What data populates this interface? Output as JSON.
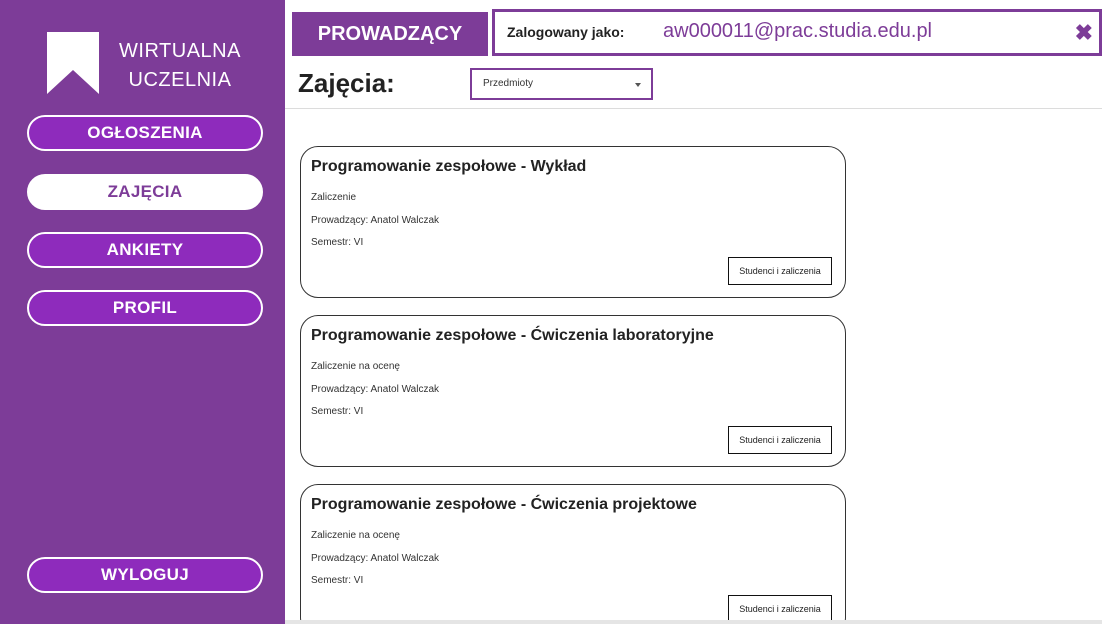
{
  "colors": {
    "brand": "#7d3c98",
    "nav_button": "#8e2bbc",
    "active_button": "#ffffff"
  },
  "logo": {
    "line1": "WIRTUALNA",
    "line2": "UCZELNIA",
    "icon": "bookmark-icon"
  },
  "nav": {
    "items": [
      {
        "label": "OGŁOSZENIA",
        "active": false
      },
      {
        "label": "ZAJĘCIA",
        "active": true
      },
      {
        "label": "ANKIETY",
        "active": false
      },
      {
        "label": "PROFIL",
        "active": false
      }
    ],
    "logout": "WYLOGUJ"
  },
  "header": {
    "role": "PROWADZĄCY",
    "logged_label": "Zalogowany jako:",
    "email": "aw000011@prac.studia.edu.pl",
    "close_icon": "close-icon"
  },
  "page": {
    "title": "Zajęcia:",
    "filter": {
      "selected": "Przedmioty"
    }
  },
  "courses": [
    {
      "title": "Programowanie zespołowe - Wykład",
      "assessment": "Zaliczenie",
      "teacher": "Prowadzący: Anatol Walczak",
      "semester": "Semestr: VI",
      "button": "Studenci i zaliczenia"
    },
    {
      "title": "Programowanie zespołowe - Ćwiczenia laboratoryjne",
      "assessment": "Zaliczenie na ocenę",
      "teacher": "Prowadzący: Anatol Walczak",
      "semester": "Semestr: VI",
      "button": "Studenci i zaliczenia"
    },
    {
      "title": "Programowanie zespołowe - Ćwiczenia projektowe",
      "assessment": "Zaliczenie na ocenę",
      "teacher": "Prowadzący: Anatol Walczak",
      "semester": "Semestr: VI",
      "button": "Studenci i zaliczenia"
    }
  ]
}
